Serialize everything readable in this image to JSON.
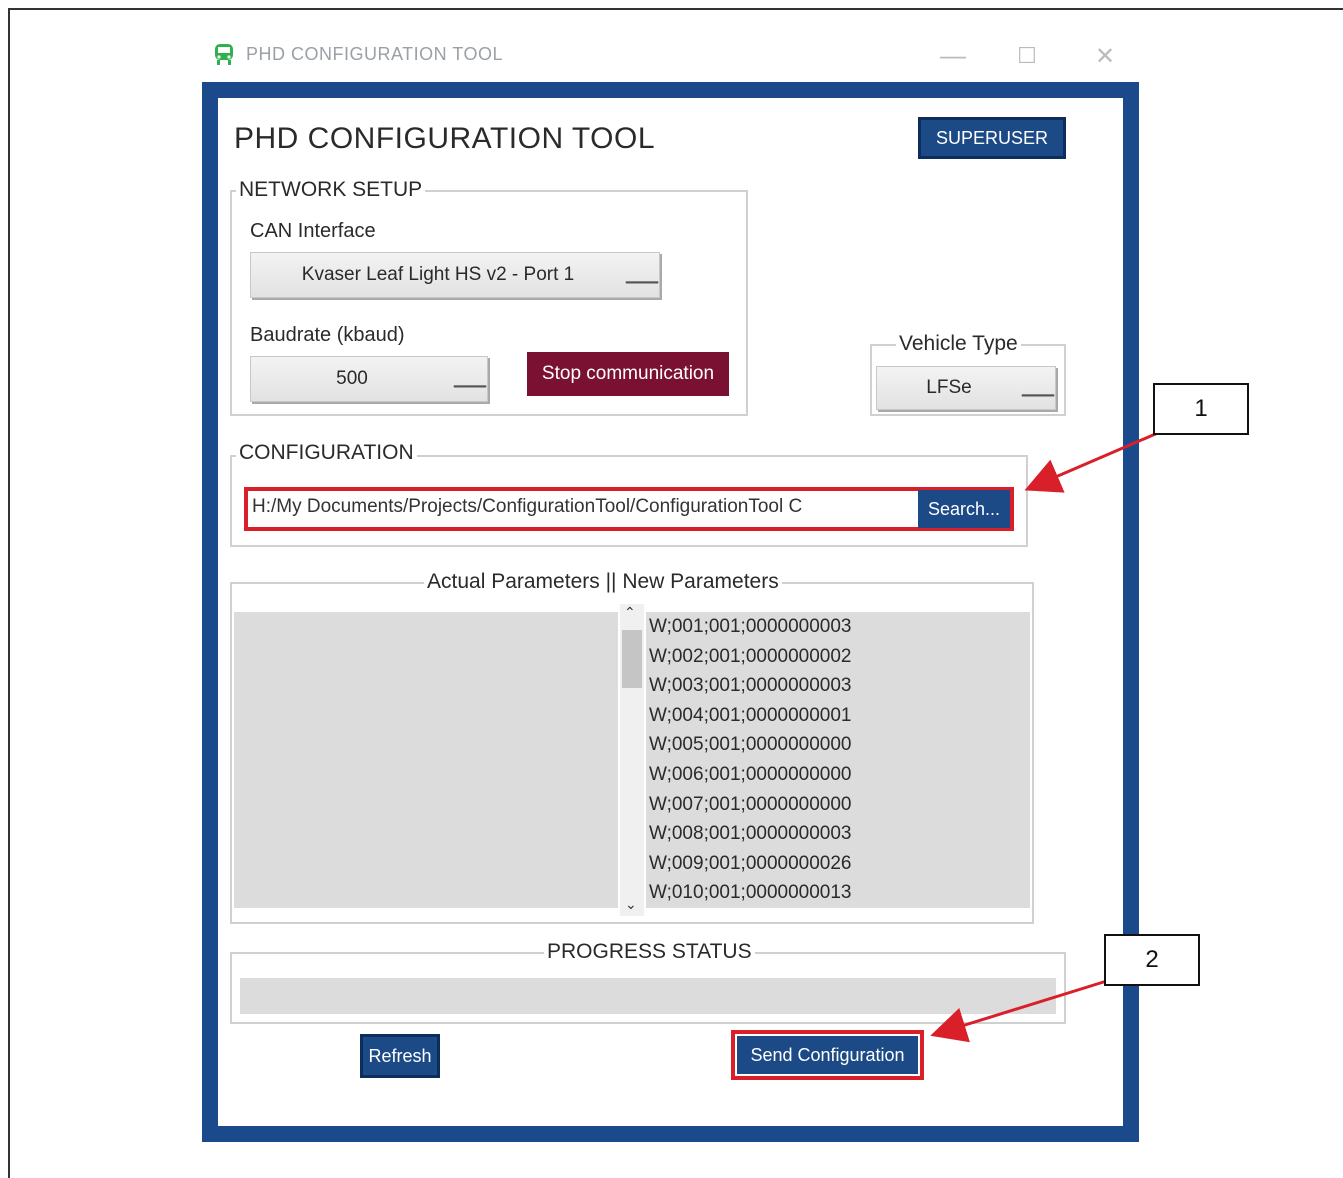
{
  "window": {
    "titlebar_title": "PHD CONFIGURATION TOOL",
    "minimize_glyph": "—",
    "maximize_glyph": "☐",
    "close_glyph": "✕",
    "frame_color": "#1b4a8c"
  },
  "app": {
    "title": "PHD CONFIGURATION TOOL",
    "superuser_label": "SUPERUSER"
  },
  "network_setup": {
    "legend": "NETWORK SETUP",
    "can_interface_label": "CAN Interface",
    "can_interface_value": "Kvaser Leaf Light HS v2 - Port 1",
    "baudrate_label": "Baudrate (kbaud)",
    "baudrate_value": "500",
    "stop_button_label": "Stop communication"
  },
  "vehicle_type": {
    "legend": "Vehicle Type",
    "value": "LFSe"
  },
  "configuration": {
    "legend": "CONFIGURATION",
    "path_value": "H:/My Documents/Projects/ConfigurationTool/ConfigurationTool C",
    "search_label": "Search..."
  },
  "parameters": {
    "legend": "Actual Parameters || New Parameters",
    "new_parameters": [
      "W;001;001;0000000003",
      "W;002;001;0000000002",
      "W;003;001;0000000003",
      "W;004;001;0000000001",
      "W;005;001;0000000000",
      "W;006;001;0000000000",
      "W;007;001;0000000000",
      "W;008;001;0000000003",
      "W;009;001;0000000026",
      "W;010;001;0000000013"
    ]
  },
  "progress": {
    "legend": "PROGRESS STATUS",
    "value_percent": 0
  },
  "actions": {
    "refresh_label": "Refresh",
    "send_label": "Send Configuration"
  },
  "callouts": [
    {
      "label": "1"
    },
    {
      "label": "2"
    }
  ],
  "colors": {
    "accent_blue": "#1c4a87",
    "stop_red": "#7a1133",
    "highlight_red": "#d9202a"
  }
}
